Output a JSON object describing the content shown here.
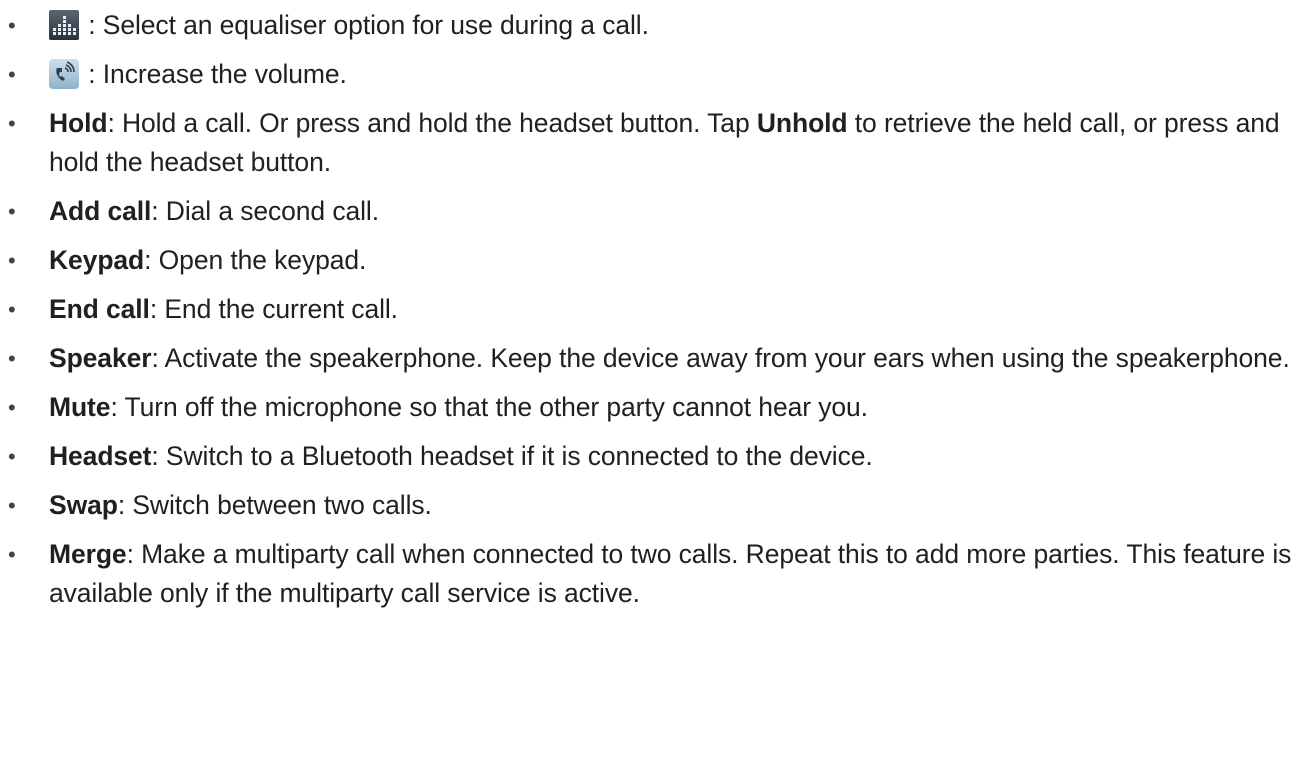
{
  "items": [
    {
      "icon": "equaliser-icon",
      "term": "",
      "text": " : Select an equaliser option for use during a call."
    },
    {
      "icon": "volume-up-icon",
      "term": "",
      "text": " : Increase the volume."
    },
    {
      "term": "Hold",
      "text": ": Hold a call. Or press and hold the headset button. Tap ",
      "term2": "Unhold",
      "text2": " to retrieve the held call, or press and hold the headset button."
    },
    {
      "term": "Add call",
      "text": ": Dial a second call."
    },
    {
      "term": "Keypad",
      "text": ": Open the keypad."
    },
    {
      "term": "End call",
      "text": ": End the current call."
    },
    {
      "term": "Speaker",
      "text": ": Activate the speakerphone. Keep the device away from your ears when using the speakerphone."
    },
    {
      "term": "Mute",
      "text": ": Turn off the microphone so that the other party cannot hear you."
    },
    {
      "term": "Headset",
      "text": ": Switch to a Bluetooth headset if it is connected to the device."
    },
    {
      "term": "Swap",
      "text": ": Switch between two calls."
    },
    {
      "term": "Merge",
      "text": ": Make a multiparty call when connected to two calls. Repeat this to add more parties. This feature is available only if the multiparty call service is active."
    }
  ],
  "bullet": "•"
}
